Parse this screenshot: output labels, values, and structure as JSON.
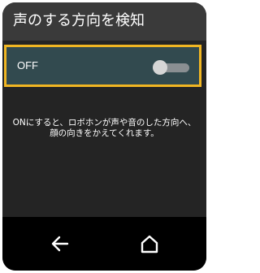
{
  "screen": {
    "title": "声のする方向を検知"
  },
  "setting": {
    "state_label": "OFF",
    "enabled": false,
    "description": "ONにすると、ロボホンが声や音のした方向へ、顔の向きをかえてくれます。"
  },
  "navigation": {
    "back_icon": "back-arrow-icon",
    "home_icon": "home-icon"
  },
  "colors": {
    "highlight_border": "#f0b623",
    "row_background": "#324a4f",
    "title_bar": "#3a3a3a",
    "screen_background": "#242424",
    "nav_bar": "#000000"
  }
}
